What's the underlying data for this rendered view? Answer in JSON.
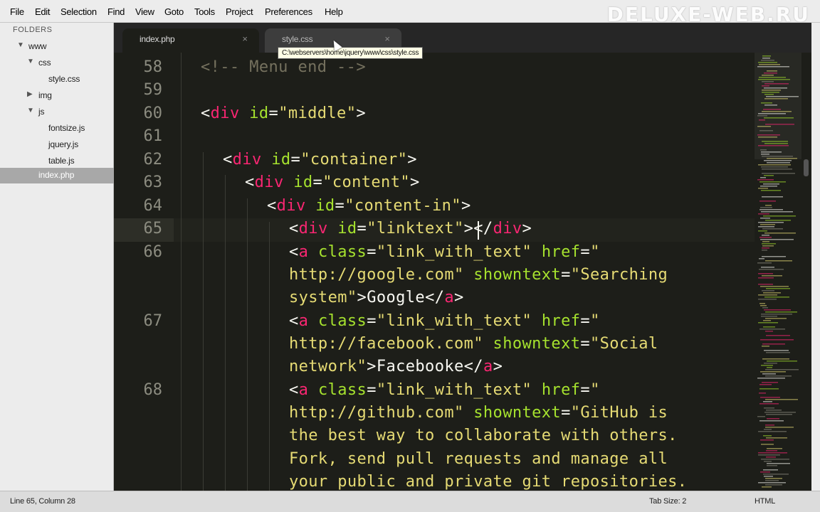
{
  "menu": [
    "File",
    "Edit",
    "Selection",
    "Find",
    "View",
    "Goto",
    "Tools",
    "Project",
    "Preferences",
    "Help"
  ],
  "watermark": "DELUXE-WEB.RU",
  "sidebar": {
    "header": "FOLDERS",
    "items": [
      {
        "label": "www",
        "arrow": "▼"
      },
      {
        "label": "css",
        "arrow": "▼"
      },
      {
        "label": "style.css",
        "arrow": ""
      },
      {
        "label": "img",
        "arrow": "▶"
      },
      {
        "label": "js",
        "arrow": "▼"
      },
      {
        "label": "fontsize.js",
        "arrow": ""
      },
      {
        "label": "jquery.js",
        "arrow": ""
      },
      {
        "label": "table.js",
        "arrow": ""
      },
      {
        "label": "index.php",
        "arrow": ""
      }
    ]
  },
  "tabs": [
    {
      "label": "index.php",
      "close": "×"
    },
    {
      "label": "style.css",
      "close": "×"
    }
  ],
  "tooltip": "C:\\webservers\\home\\jquery\\www\\css\\style.css",
  "editor": {
    "line_numbers": [
      "58",
      "59",
      "60",
      "61",
      "62",
      "63",
      "64",
      "65",
      "66",
      "67",
      "68"
    ],
    "code": {
      "l58": "<!-- Menu end -->",
      "l60": {
        "open": "<",
        "tag": "div",
        "attr": " id",
        "eq": "=",
        "val": "\"middle\"",
        "close": ">"
      },
      "l62": {
        "open": "<",
        "tag": "div",
        "attr": " id",
        "eq": "=",
        "val": "\"container\"",
        "close": ">"
      },
      "l63": {
        "open": "<",
        "tag": "div",
        "attr": " id",
        "eq": "=",
        "val": "\"content\"",
        "close": ">"
      },
      "l64": {
        "open": "<",
        "tag": "div",
        "attr": " id",
        "eq": "=",
        "val": "\"content-in\"",
        "close": ">"
      },
      "l65": {
        "open": "<",
        "tag": "div",
        "attr": " id",
        "eq": "=",
        "val": "\"linktext\"",
        "mid": "></",
        "tag2": "div",
        "close": ">"
      },
      "l66a": {
        "open": "<",
        "tag": "a",
        "attr1": " class",
        "eq": "=",
        "val1": "\"link_with_text\"",
        "attr2": " href",
        "val2a": "\""
      },
      "l66b": {
        "val2b": "http://google.com\"",
        "attr3": " showntext",
        "eq": "=",
        "val3a": "\"Searching"
      },
      "l66c": {
        "val3b": "system\"",
        "gt": ">",
        "text": "Google",
        "lt": "</",
        "tag": "a",
        "close": ">"
      },
      "l67a": {
        "open": "<",
        "tag": "a",
        "attr1": " class",
        "eq": "=",
        "val1": "\"link_with_text\"",
        "attr2": " href",
        "val2a": "\""
      },
      "l67b": {
        "val2b": "http://facebook.com\"",
        "attr3": " showntext",
        "eq": "=",
        "val3a": "\"Social"
      },
      "l67c": {
        "val3b": "network\"",
        "gt": ">",
        "text": "Facebooke",
        "lt": "</",
        "tag": "a",
        "close": ">"
      },
      "l68a": {
        "open": "<",
        "tag": "a",
        "attr1": " class",
        "eq": "=",
        "val1": "\"link_with_text\"",
        "attr2": " href",
        "val2a": "\""
      },
      "l68b": {
        "val2b": "http://github.com\"",
        "attr3": " showntext",
        "eq": "=",
        "val3a": "\"GitHub is"
      },
      "l68c": "the best way to collaborate with others.",
      "l68d": "Fork, send pull requests and manage all",
      "l68e": "your public and private git repositories."
    }
  },
  "status": {
    "position": "Line 65, Column 28",
    "tab_size": "Tab Size: 2",
    "syntax": "HTML"
  },
  "colors": {
    "background": "#1d1e19",
    "tag": "#f92672",
    "attribute": "#a6e22e",
    "string": "#e6db74",
    "comment": "#75715e"
  }
}
